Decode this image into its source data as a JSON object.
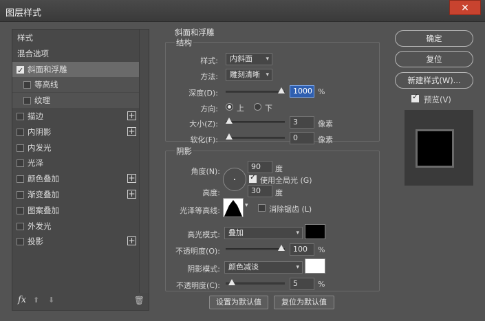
{
  "window": {
    "title": "图层样式",
    "close_glyph": "✕"
  },
  "left_panel": {
    "items": [
      {
        "label": "样式",
        "checkbox": false,
        "checked": false,
        "plus": false,
        "state": "normal"
      },
      {
        "label": "混合选项",
        "checkbox": false,
        "checked": false,
        "plus": false,
        "state": "normal"
      },
      {
        "label": "斜面和浮雕",
        "checkbox": true,
        "checked": true,
        "plus": false,
        "state": "selected"
      },
      {
        "label": "等高线",
        "checkbox": true,
        "checked": false,
        "plus": false,
        "state": "sub"
      },
      {
        "label": "纹理",
        "checkbox": true,
        "checked": false,
        "plus": false,
        "state": "sub"
      },
      {
        "label": "描边",
        "checkbox": true,
        "checked": false,
        "plus": true,
        "state": "normal"
      },
      {
        "label": "内阴影",
        "checkbox": true,
        "checked": false,
        "plus": true,
        "state": "normal"
      },
      {
        "label": "内发光",
        "checkbox": true,
        "checked": false,
        "plus": false,
        "state": "normal"
      },
      {
        "label": "光泽",
        "checkbox": true,
        "checked": false,
        "plus": false,
        "state": "normal"
      },
      {
        "label": "颜色叠加",
        "checkbox": true,
        "checked": false,
        "plus": true,
        "state": "normal"
      },
      {
        "label": "渐变叠加",
        "checkbox": true,
        "checked": false,
        "plus": true,
        "state": "normal"
      },
      {
        "label": "图案叠加",
        "checkbox": true,
        "checked": false,
        "plus": false,
        "state": "normal"
      },
      {
        "label": "外发光",
        "checkbox": true,
        "checked": false,
        "plus": false,
        "state": "normal"
      },
      {
        "label": "投影",
        "checkbox": true,
        "checked": false,
        "plus": true,
        "state": "normal"
      }
    ],
    "plus_glyph": "+",
    "footer": {
      "fx": "fx",
      "up_glyph": "⬆",
      "down_glyph": "⬇",
      "trash_glyph": "🗑"
    }
  },
  "bevel": {
    "section_title": "斜面和浮雕",
    "structure": {
      "title": "结构",
      "style_label": "样式:",
      "style_value": "内斜面",
      "technique_label": "方法:",
      "technique_value": "雕刻清晰",
      "depth_label": "深度(D):",
      "depth_value": "1000",
      "depth_unit": "%",
      "depth_level": 1.0,
      "direction_label": "方向:",
      "direction_up": "上",
      "direction_down": "下",
      "direction_selected": "上",
      "size_label": "大小(Z):",
      "size_value": "3",
      "size_unit": "像素",
      "size_level": 0.0,
      "soften_label": "软化(F):",
      "soften_value": "0",
      "soften_unit": "像素",
      "soften_level": 0.0
    },
    "shading": {
      "title": "阴影",
      "angle_label": "角度(N):",
      "angle_value": "90",
      "angle_unit": "度",
      "global_light_label": "使用全局光 (G)",
      "global_light_checked": true,
      "altitude_label": "高度:",
      "altitude_value": "30",
      "altitude_unit": "度",
      "gloss_contour_label": "光泽等高线:",
      "anti_alias_label": "消除锯齿 (L)",
      "anti_alias_checked": false,
      "highlight_mode_label": "高光模式:",
      "highlight_mode_value": "叠加",
      "highlight_color": "#000000",
      "highlight_opacity_label": "不透明度(O):",
      "highlight_opacity_value": "100",
      "highlight_opacity_unit": "%",
      "highlight_opacity_level": 1.0,
      "shadow_mode_label": "阴影模式:",
      "shadow_mode_value": "颜色减淡",
      "shadow_color": "#ffffff",
      "shadow_opacity_label": "不透明度(C):",
      "shadow_opacity_value": "5",
      "shadow_opacity_unit": "%",
      "shadow_opacity_level": 0.05
    },
    "buttons": {
      "set_default": "设置为默认值",
      "reset_default": "复位为默认值"
    }
  },
  "right_panel": {
    "ok": "确定",
    "reset": "复位",
    "new_style": "新建样式(W)...",
    "preview_label": "预览(V)",
    "preview_checked": true
  },
  "colors": {
    "accent_focus": "#2f5fb0",
    "selected_row": "#6a6a6a",
    "close_red": "#c8432f"
  }
}
